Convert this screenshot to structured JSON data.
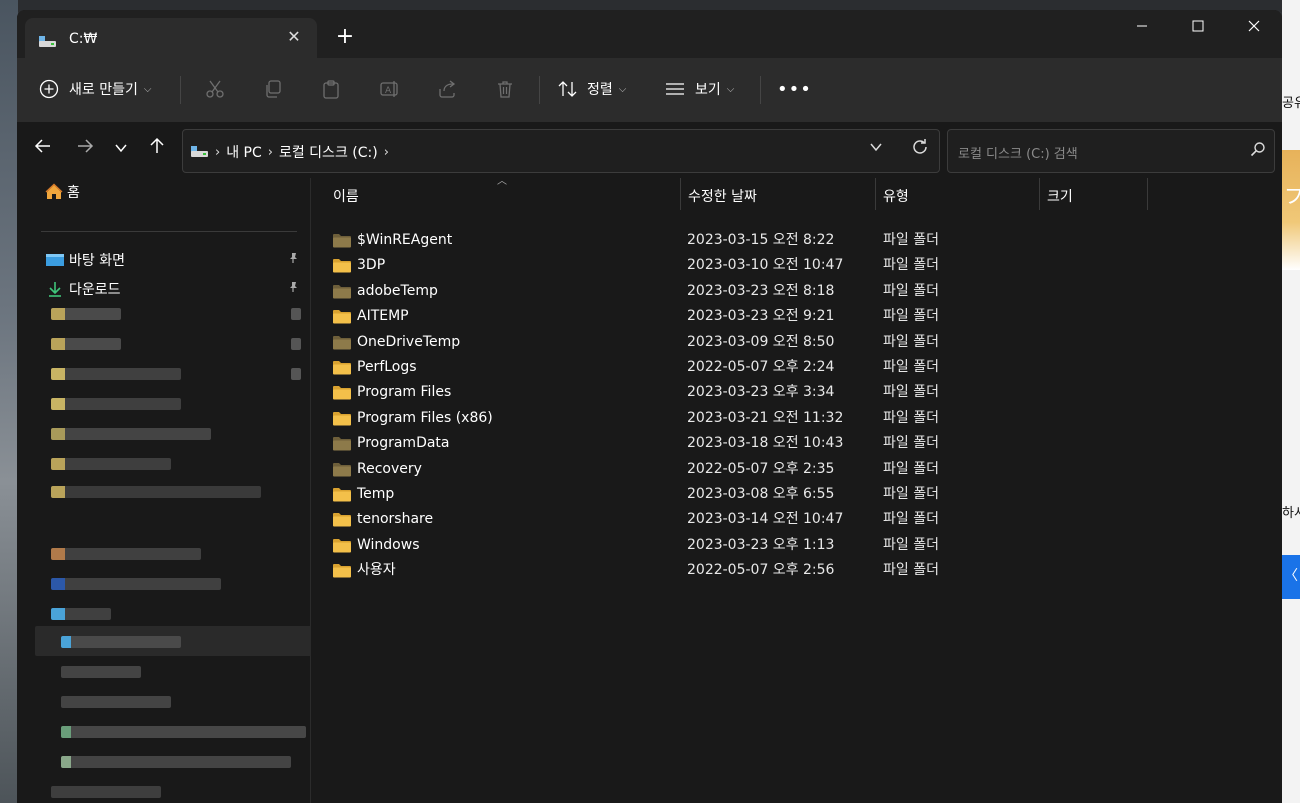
{
  "tab": {
    "title": "C:₩"
  },
  "toolbar": {
    "new_label": "새로 만들기",
    "sort_label": "정렬",
    "view_label": "보기",
    "more": "•••"
  },
  "address": {
    "crumbs": [
      "내 PC",
      "로컬 디스크 (C:)"
    ]
  },
  "search": {
    "placeholder": "로컬 디스크 (C:) 검색"
  },
  "sidebar": {
    "home": "홈",
    "items": [
      {
        "label": "바탕 화면",
        "icon": "desktop-icon",
        "pinned": true
      },
      {
        "label": "다운로드",
        "icon": "download-icon",
        "pinned": true
      }
    ]
  },
  "columns": {
    "name": "이름",
    "date": "수정한 날짜",
    "type": "유형",
    "size": "크기"
  },
  "files": [
    {
      "name": "$WinREAgent",
      "date": "2023-03-15 오전 8:22",
      "type": "파일 폴더",
      "dim": true
    },
    {
      "name": "3DP",
      "date": "2023-03-10 오전 10:47",
      "type": "파일 폴더",
      "dim": false
    },
    {
      "name": "adobeTemp",
      "date": "2023-03-23 오전 8:18",
      "type": "파일 폴더",
      "dim": true
    },
    {
      "name": "AITEMP",
      "date": "2023-03-23 오전 9:21",
      "type": "파일 폴더",
      "dim": false
    },
    {
      "name": "OneDriveTemp",
      "date": "2023-03-09 오전 8:50",
      "type": "파일 폴더",
      "dim": true
    },
    {
      "name": "PerfLogs",
      "date": "2022-05-07 오후 2:24",
      "type": "파일 폴더",
      "dim": false
    },
    {
      "name": "Program Files",
      "date": "2023-03-23 오후 3:34",
      "type": "파일 폴더",
      "dim": false
    },
    {
      "name": "Program Files (x86)",
      "date": "2023-03-21 오전 11:32",
      "type": "파일 폴더",
      "dim": false
    },
    {
      "name": "ProgramData",
      "date": "2023-03-18 오전 10:43",
      "type": "파일 폴더",
      "dim": true
    },
    {
      "name": "Recovery",
      "date": "2022-05-07 오후 2:35",
      "type": "파일 폴더",
      "dim": true
    },
    {
      "name": "Temp",
      "date": "2023-03-08 오후 6:55",
      "type": "파일 폴더",
      "dim": false
    },
    {
      "name": "tenorshare",
      "date": "2023-03-14 오전 10:47",
      "type": "파일 폴더",
      "dim": false
    },
    {
      "name": "Windows",
      "date": "2023-03-23 오후 1:13",
      "type": "파일 폴더",
      "dim": false
    },
    {
      "name": "사용자",
      "date": "2022-05-07 오후 2:56",
      "type": "파일 폴더",
      "dim": false
    }
  ],
  "desktop_bg": {
    "right_fragments": [
      "공유",
      "하시"
    ],
    "orange_glyph": "フ",
    "blue_glyph": "〈"
  },
  "colors": {
    "folder": "#f3c04a",
    "folder_dim": "#8d7a4a",
    "window_bg": "#191919",
    "toolbar_bg": "#2c2c2c"
  }
}
